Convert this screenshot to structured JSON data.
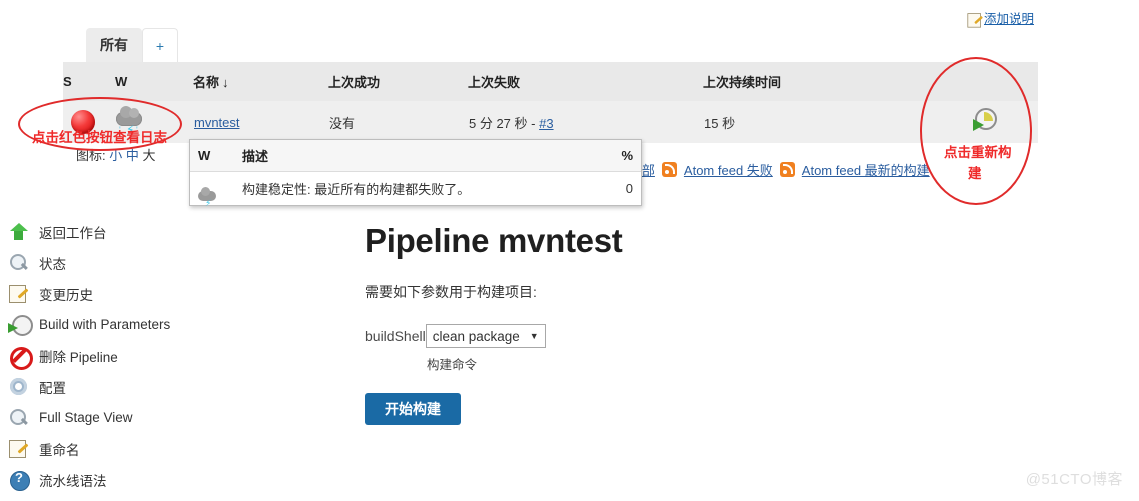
{
  "header": {
    "add_description_label": "添加说明",
    "add_description_icon": "note-pencil-icon"
  },
  "tabs": [
    {
      "label": "所有",
      "active": true
    },
    {
      "label": "+",
      "active": false
    }
  ],
  "jobs_table": {
    "columns": [
      "S",
      "W",
      "名称",
      "上次成功",
      "上次失败",
      "上次持续时间",
      ""
    ],
    "sort_column": "名称",
    "sort_arrow": "↓",
    "rows": [
      {
        "status_icon": "red-ball-failed-icon",
        "weather_icon": "storm-cloud-icon",
        "name": "mvntest",
        "last_success": "没有",
        "last_failure": "5 分 27 秒 - ",
        "last_failure_build": "#3",
        "last_duration": "15 秒",
        "action_icon": "schedule-build-icon"
      }
    ]
  },
  "legend": {
    "prefix": "图标:",
    "small": "小",
    "medium": "中",
    "large": "大"
  },
  "weather_tooltip": {
    "columns": [
      "W",
      "描述",
      "%"
    ],
    "rows": [
      {
        "icon": "storm-cloud-icon",
        "description": "构建稳定性: 最近所有的构建都失败了。",
        "percent": "0"
      }
    ]
  },
  "feeds": [
    {
      "label": "feed 全部",
      "icon": "rss-icon",
      "icon_hidden": true
    },
    {
      "label": "Atom feed 失败",
      "icon": "rss-icon",
      "icon_hidden": false
    },
    {
      "label": "Atom feed 最新的构建",
      "icon": "rss-icon",
      "icon_hidden": false
    }
  ],
  "sidebar": {
    "items": [
      {
        "label": "返回工作台",
        "icon": "up-arrow-icon"
      },
      {
        "label": "状态",
        "icon": "search-icon"
      },
      {
        "label": "变更历史",
        "icon": "note-pencil-icon"
      },
      {
        "label": "Build with Parameters",
        "icon": "schedule-build-icon"
      },
      {
        "label": "删除 Pipeline",
        "icon": "delete-forbidden-icon"
      },
      {
        "label": "配置",
        "icon": "gear-icon"
      },
      {
        "label": "Full Stage View",
        "icon": "search-icon"
      },
      {
        "label": "重命名",
        "icon": "note-pencil-icon"
      },
      {
        "label": "流水线语法",
        "icon": "help-question-icon"
      }
    ]
  },
  "main": {
    "title": "Pipeline mvntest",
    "lead": "需要如下参数用于构建项目:",
    "param": {
      "label": "buildShell",
      "value": "clean package",
      "caret": "▼",
      "hint": "构建命令"
    },
    "build_button": "开始构建"
  },
  "annotations": [
    {
      "text": "点击红色按钮查看日志",
      "name": "annotation-click-red-button"
    },
    {
      "text": "点击重新构",
      "name": "annotation-click-rebuild-line1"
    },
    {
      "text": "建",
      "name": "annotation-click-rebuild-line2"
    }
  ],
  "watermark": "@51CTO博客",
  "colors": {
    "accent_blue": "#1a6aa5",
    "link_blue": "#2a5d9f",
    "annotation_red": "#ef2a2a",
    "rss_orange": "#f08020",
    "status_failed": "#cc0000"
  }
}
